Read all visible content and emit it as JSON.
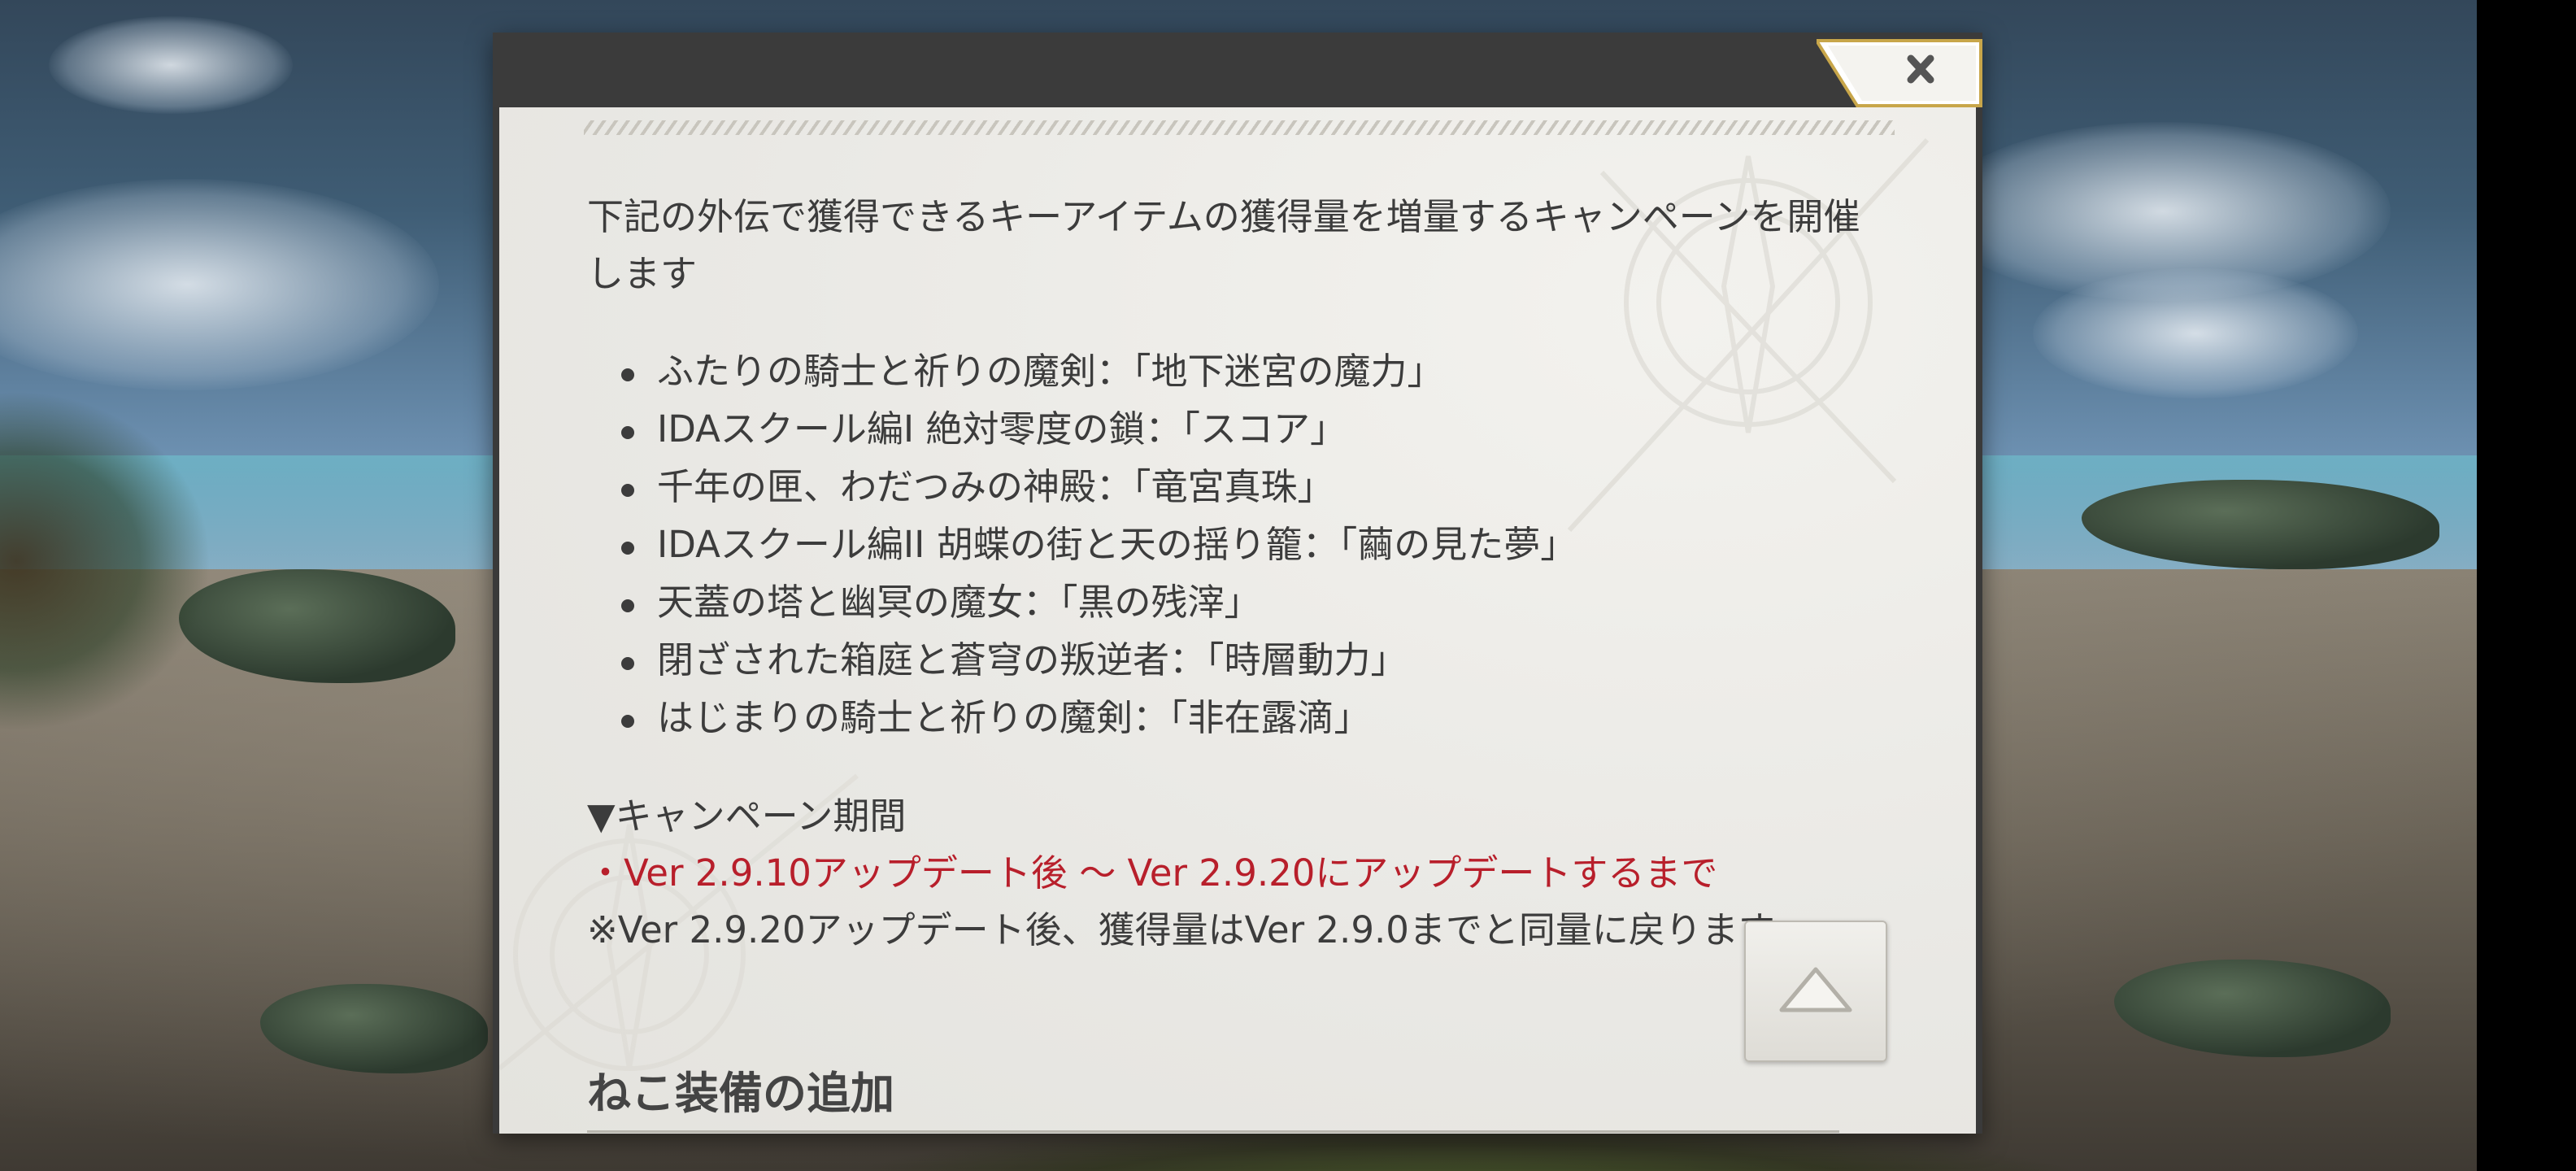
{
  "dialog": {
    "close_icon": "close-x-icon",
    "intro": "下記の外伝で獲得できるキーアイテムの獲得量を増量するキャンペーンを開催します",
    "items": [
      {
        "text": "ふたりの騎士と祈りの魔剣：「地下迷宮の魔力」"
      },
      {
        "text": "IDAスクール編I 絶対零度の鎖：「スコア」"
      },
      {
        "text": "千年の匣、わだつみの神殿：「竜宮真珠」"
      },
      {
        "text": "IDAスクール編II 胡蝶の街と天の揺り籠：「繭の見た夢」"
      },
      {
        "text": "天蓋の塔と幽冥の魔女：「黒の残滓」"
      },
      {
        "text": "閉ざされた箱庭と蒼穹の叛逆者：「時層動力」"
      },
      {
        "text": "はじまりの騎士と祈りの魔剣：「非在露滴」"
      }
    ],
    "period_heading": "▼キャンペーン期間",
    "period_text": "・Ver 2.9.10アップデート後 〜 Ver 2.9.20にアップデートするまで",
    "note": "※Ver 2.9.20アップデート後、獲得量はVer 2.9.0までと同量に戻ります",
    "section_title": "ねこ装備の追加",
    "scroll_top_icon": "chevron-up-icon"
  },
  "colors": {
    "accent_red": "#b81f2b",
    "text": "#3c3c3c",
    "close_border": "#c8a64a"
  }
}
